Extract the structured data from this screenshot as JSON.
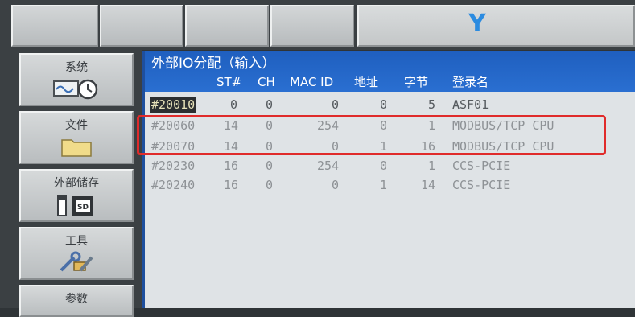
{
  "top_bar": {
    "indicator": "Y"
  },
  "menu": [
    {
      "label": "系统",
      "icon": "system-clock-icon"
    },
    {
      "label": "文件",
      "icon": "folder-icon"
    },
    {
      "label": "外部储存",
      "icon": "sd-card-icon"
    },
    {
      "label": "工具",
      "icon": "tools-icon"
    },
    {
      "label": "参数",
      "icon": ""
    }
  ],
  "panel": {
    "title": "外部IO分配（输入）",
    "columns": [
      "ST#",
      "CH",
      "MAC ID",
      "地址",
      "字节",
      "登录名"
    ],
    "rows": [
      {
        "id": "#20010",
        "st": "0",
        "ch": "0",
        "mac": "0",
        "addr": "0",
        "bytes": "5",
        "name": "ASF01"
      },
      {
        "id": "#20060",
        "st": "14",
        "ch": "0",
        "mac": "254",
        "addr": "0",
        "bytes": "1",
        "name": "MODBUS/TCP CPU"
      },
      {
        "id": "#20070",
        "st": "14",
        "ch": "0",
        "mac": "0",
        "addr": "1",
        "bytes": "16",
        "name": "MODBUS/TCP CPU"
      },
      {
        "id": "#20230",
        "st": "16",
        "ch": "0",
        "mac": "254",
        "addr": "0",
        "bytes": "1",
        "name": "CCS-PCIE"
      },
      {
        "id": "#20240",
        "st": "16",
        "ch": "0",
        "mac": "0",
        "addr": "1",
        "bytes": "14",
        "name": "CCS-PCIE"
      }
    ]
  },
  "colors": {
    "title_bar": "#1f5fbf",
    "highlight_box": "#e02b2b",
    "indicator": "#2b8be0"
  }
}
